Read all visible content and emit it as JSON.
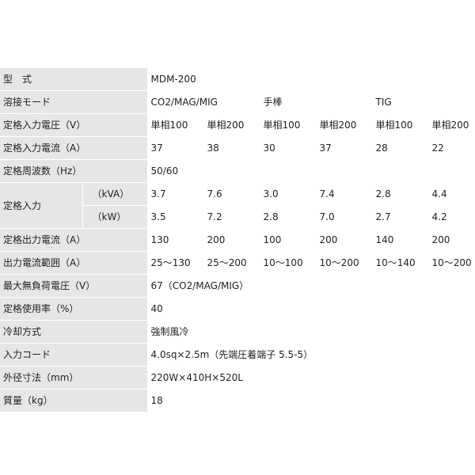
{
  "spec": {
    "model": {
      "label": "型　式",
      "value": "MDM-200"
    },
    "mode": {
      "label": "溶接モード",
      "values": [
        "CO2/MAG/MIG",
        "手棒",
        "TIG"
      ]
    },
    "rated_voltage": {
      "label": "定格入力電圧（V）",
      "values": [
        "単相100",
        "単相200",
        "単相100",
        "単相200",
        "単相100",
        "単相200"
      ]
    },
    "rated_current": {
      "label": "定格入力電流（A）",
      "values": [
        "37",
        "38",
        "30",
        "37",
        "28",
        "22"
      ]
    },
    "frequency": {
      "label": "定格周波数（Hz）",
      "value": "50/60"
    },
    "rated_input": {
      "label": "定格入力",
      "kva": {
        "unit": "（kVA）",
        "values": [
          "3.7",
          "7.6",
          "3.0",
          "7.4",
          "2.8",
          "4.4"
        ]
      },
      "kw": {
        "unit": "（kW）",
        "values": [
          "3.5",
          "7.2",
          "2.8",
          "7.0",
          "2.7",
          "4.2"
        ]
      }
    },
    "output_current": {
      "label": "定格出力電流（A）",
      "values": [
        "130",
        "200",
        "100",
        "200",
        "140",
        "200"
      ]
    },
    "output_range": {
      "label": "出力電流範囲（A）",
      "values": [
        "25～130",
        "25～200",
        "10～100",
        "10～200",
        "10～140",
        "10～200"
      ]
    },
    "max_no_load": {
      "label": "最大無負荷電圧（V）",
      "value": "67（CO2/MAG/MIG）"
    },
    "duty_cycle": {
      "label": "定格使用率（%）",
      "value": "40"
    },
    "cooling": {
      "label": "冷却方式",
      "value": "強制風冷"
    },
    "input_cord": {
      "label": "入力コード",
      "value": "4.0sq×2.5m（先端圧着端子 5.5-5）"
    },
    "dimensions": {
      "label": "外径寸法（mm）",
      "value": "220W×410H×520L"
    },
    "mass": {
      "label": "質量（kg）",
      "value": "18"
    }
  }
}
